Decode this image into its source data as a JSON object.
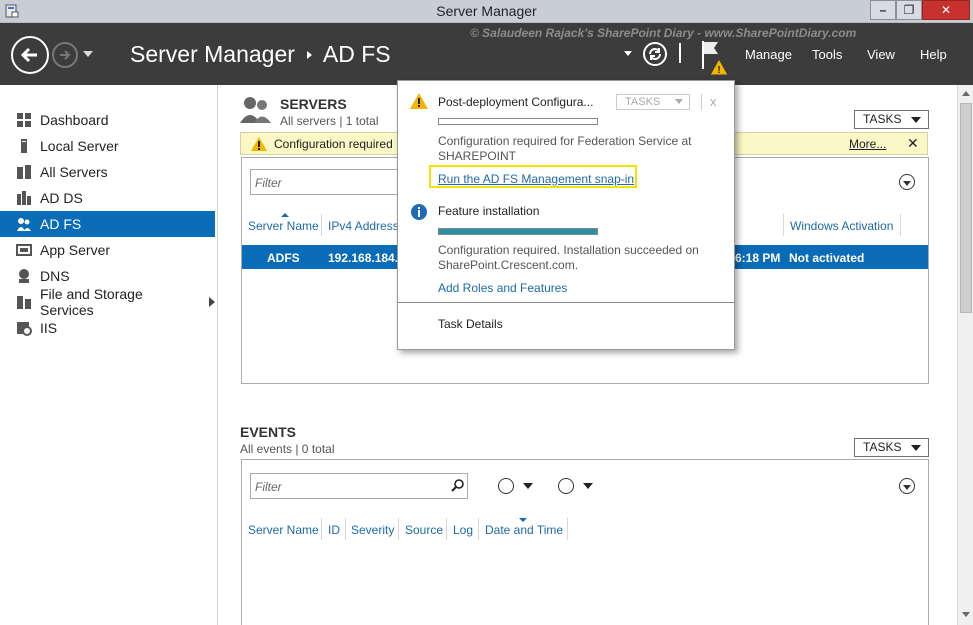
{
  "window": {
    "title": "Server Manager",
    "min_label": "–",
    "max_label": "❐",
    "close_label": "✕"
  },
  "header": {
    "breadcrumb": [
      "Server Manager",
      "AD FS"
    ],
    "watermark": "© Salaudeen Rajack's SharePoint Diary - www.SharePointDiary.com",
    "menu": [
      "Manage",
      "Tools",
      "View",
      "Help"
    ]
  },
  "sidebar": {
    "items": [
      {
        "label": "Dashboard",
        "icon": "dashboard-icon",
        "active": false
      },
      {
        "label": "Local Server",
        "icon": "server-icon",
        "active": false
      },
      {
        "label": "All Servers",
        "icon": "servers-icon",
        "active": false
      },
      {
        "label": "AD DS",
        "icon": "ad-ds-icon",
        "active": false
      },
      {
        "label": "AD FS",
        "icon": "ad-fs-icon",
        "active": true
      },
      {
        "label": "App Server",
        "icon": "app-server-icon",
        "active": false
      },
      {
        "label": "DNS",
        "icon": "dns-icon",
        "active": false
      },
      {
        "label": "File and Storage Services",
        "icon": "storage-icon",
        "active": false
      },
      {
        "label": "IIS",
        "icon": "iis-icon",
        "active": false
      }
    ]
  },
  "servers": {
    "title": "SERVERS",
    "subtitle": "All servers | 1 total",
    "tasks_label": "TASKS",
    "warning": {
      "text": "Configuration required",
      "more": "More...",
      "close": "✕"
    },
    "filter_placeholder": "Filter",
    "columns": [
      "Server Name",
      "IPv4 Address",
      "Windows Activation"
    ],
    "row": {
      "server_name": "ADFS",
      "ipv4": "192.168.184.1",
      "time_fragment": "6:18 PM",
      "activation": "Not activated"
    }
  },
  "events": {
    "title": "EVENTS",
    "subtitle": "All events | 0 total",
    "tasks_label": "TASKS",
    "filter_placeholder": "Filter",
    "columns": [
      "Server Name",
      "ID",
      "Severity",
      "Source",
      "Log",
      "Date and Time"
    ]
  },
  "popup": {
    "item1": {
      "title": "Post-deployment Configura...",
      "tasks_label": "TASKS",
      "close": "x",
      "text": "Configuration required for Federation Service at SHAREPOINT",
      "link": "Run the AD FS Management snap-in",
      "progress": 0
    },
    "item2": {
      "title": "Feature installation",
      "text": "Configuration required. Installation succeeded on SharePoint.Crescent.com.",
      "link": "Add Roles and Features",
      "progress": 1.0
    },
    "task_details": "Task Details"
  },
  "colors": {
    "accent": "#0a6bb7",
    "header_bg": "#3c3c3c",
    "warning_bg": "#fbf7c6",
    "highlight": "#f1e500",
    "link": "#1f6aa5"
  }
}
